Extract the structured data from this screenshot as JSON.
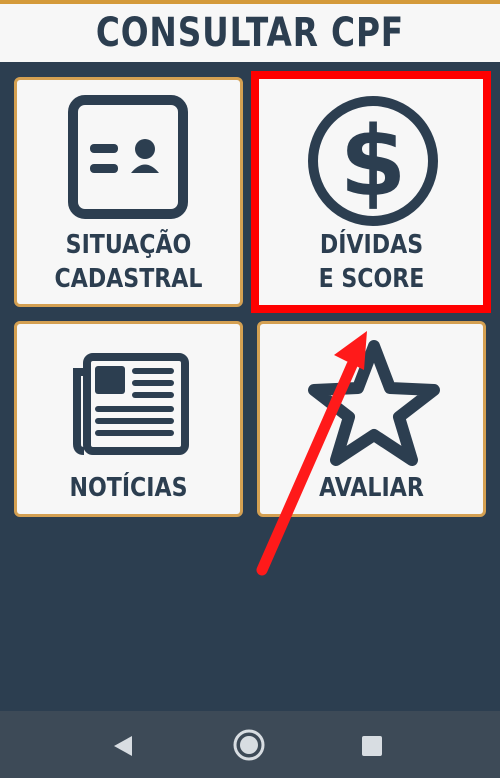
{
  "header": {
    "title": "CONSULTAR CPF"
  },
  "tiles": {
    "situacao": {
      "line1": "SITUAÇÃO",
      "line2": "CADASTRAL",
      "icon": "id-card-icon"
    },
    "dividas": {
      "line1": "DÍVIDAS",
      "line2": "E SCORE",
      "icon": "dollar-coin-icon"
    },
    "noticias": {
      "line1": "NOTÍCIAS",
      "icon": "newspaper-icon"
    },
    "avaliar": {
      "line1": "AVALIAR",
      "icon": "star-icon"
    }
  },
  "annotation": {
    "highlight_color": "#ff0000",
    "arrow_color": "#ff0000"
  },
  "colors": {
    "background": "#2c3e50",
    "tile": "#f7f7f7",
    "tile_border": "#d4a052",
    "accent_line": "#d49a3a"
  },
  "navbar": {
    "back": "back-icon",
    "home": "home-icon",
    "recents": "recents-icon"
  }
}
